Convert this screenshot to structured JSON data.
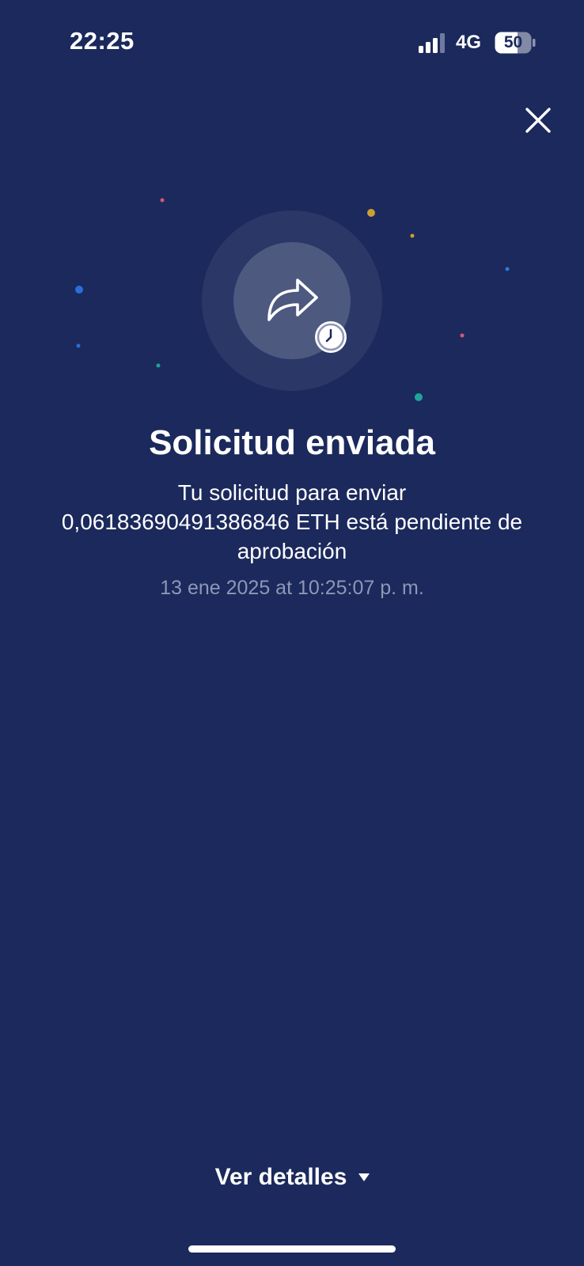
{
  "status_bar": {
    "time": "22:25",
    "network": "4G",
    "battery": "50",
    "icons": [
      "signal-icon",
      "battery-icon"
    ]
  },
  "header": {
    "close_icon": "close-icon"
  },
  "hero": {
    "icon": "share-forward-icon",
    "badge_icon": "clock-icon"
  },
  "content": {
    "title": "Solicitud enviada",
    "message_line1": "Tu solicitud para enviar",
    "message_line2": "0,06183690491386846 ETH está pendiente de",
    "message_line3": "aprobación",
    "timestamp": "13 ene 2025 at 10:25:07 p. m."
  },
  "footer": {
    "details_label": "Ver detalles",
    "details_icon": "caret-down-icon"
  },
  "colors": {
    "background": "#1b295c",
    "text_primary": "#ffffff",
    "text_secondary": "#8d97b7",
    "confetti": [
      "#2a6fd8",
      "#c9a035",
      "#e2508a",
      "#1fa39a",
      "#d05a7a",
      "#2f79d8"
    ]
  }
}
